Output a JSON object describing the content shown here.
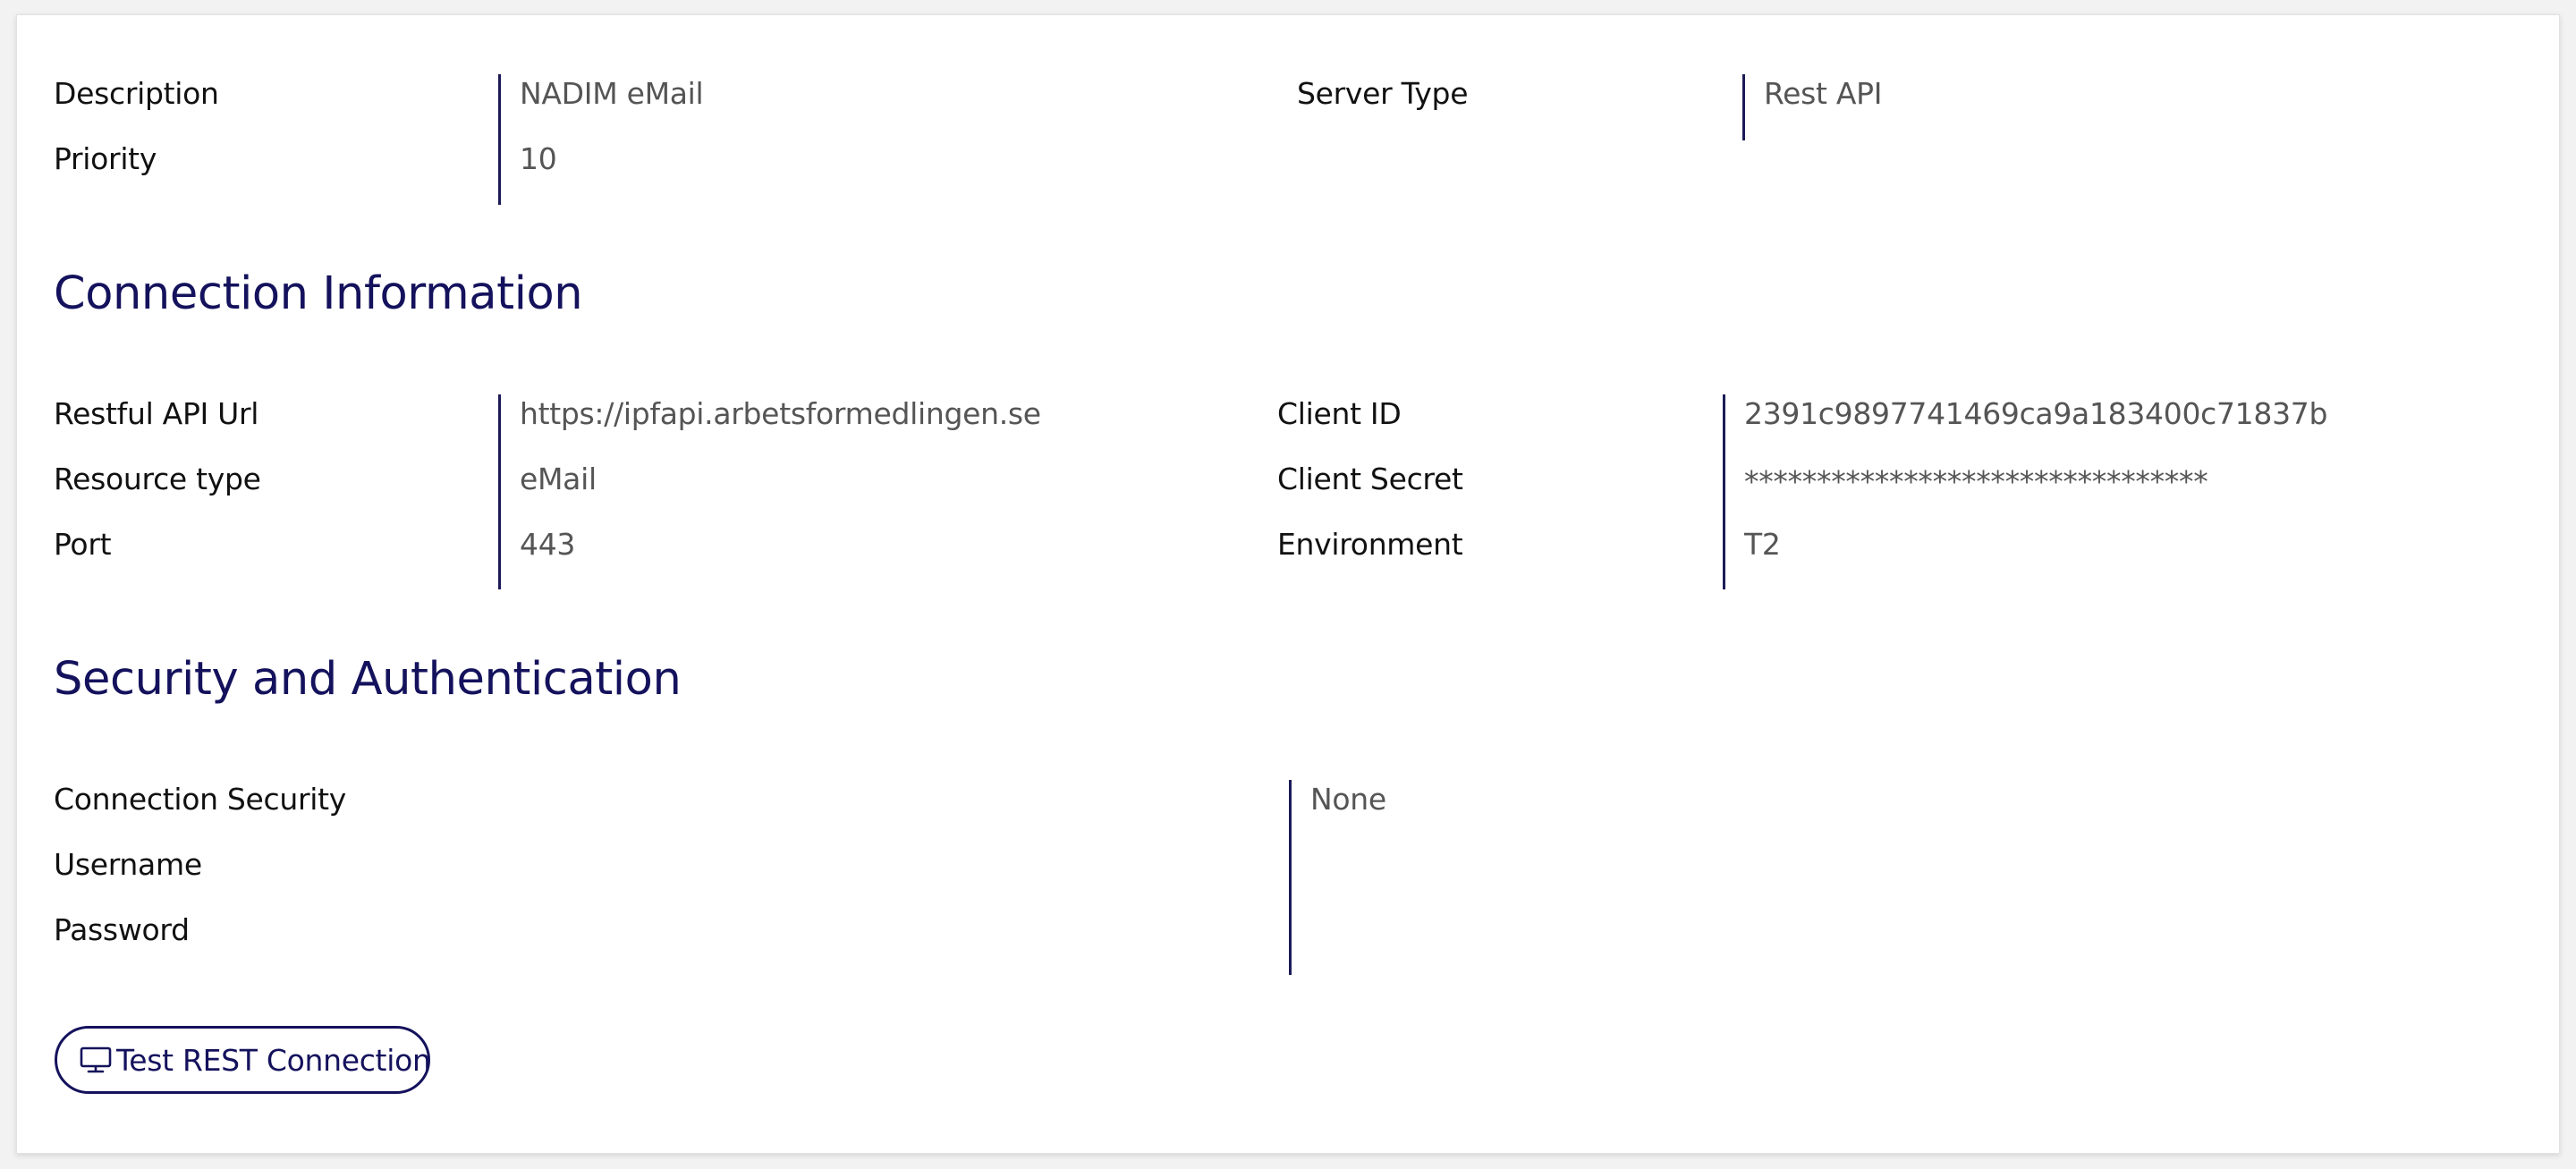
{
  "general": {
    "description_label": "Description",
    "description_value": "NADIM eMail",
    "priority_label": "Priority",
    "priority_value": "10",
    "server_type_label": "Server Type",
    "server_type_value": "Rest API"
  },
  "connection": {
    "title": "Connection Information",
    "restful_api_url_label": "Restful API Url",
    "restful_api_url_value": "https://ipfapi.arbetsformedlingen.se",
    "resource_type_label": "Resource type",
    "resource_type_value": "eMail",
    "port_label": "Port",
    "port_value": "443",
    "client_id_label": "Client ID",
    "client_id_value": "2391c9897741469ca9a183400c71837b",
    "client_secret_label": "Client Secret",
    "client_secret_value": "********************************",
    "environment_label": "Environment",
    "environment_value": "T2"
  },
  "security": {
    "title": "Security and Authentication",
    "connection_security_label": "Connection Security",
    "connection_security_value": "None",
    "username_label": "Username",
    "password_label": "Password"
  },
  "actions": {
    "test_button_label": "Test REST Connection",
    "test_button_icon": "monitor-icon"
  },
  "colors": {
    "accent": "#14125c",
    "label_text": "#111111",
    "value_text": "#555555"
  }
}
